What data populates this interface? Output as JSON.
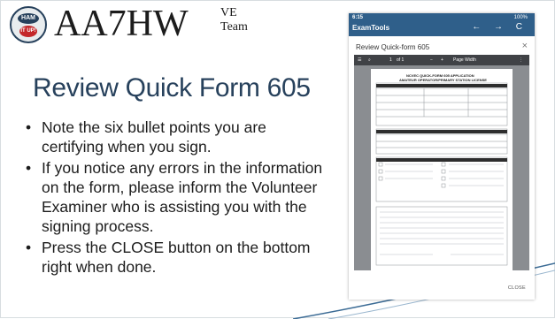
{
  "header": {
    "logo_top": "HAM",
    "logo_bottom": "IT UP!",
    "brand": "AA7HW",
    "brand_super": "VE",
    "brand_sub": "Team"
  },
  "slide": {
    "title": "Review Quick Form 605",
    "bullets": [
      "Note the six bullet points you are certifying when you sign.",
      "If you notice any errors in the information on the form, please inform the Volunteer Examiner who is assisting you with the signing process.",
      "Press the CLOSE button on the bottom right when done."
    ]
  },
  "app": {
    "status_time": "6:15",
    "battery": "100%",
    "app_name": "ExamTools",
    "nav_icons": "← → C",
    "dialog_title": "Review Quick-form 605",
    "close_x": "×",
    "pdf_toolbar": {
      "page": "1",
      "of": "of 1",
      "zoom": "Page Width"
    },
    "pdf_heading1": "NCVEC QUICK-FORM 605 APPLICATION",
    "pdf_heading2": "AMATEUR OPERATOR/PRIMARY STATION LICENSE",
    "close_button": "CLOSE"
  },
  "colors": {
    "title": "#27415c",
    "statusbar": "#2f5f8a",
    "pdf_toolbar": "#404246",
    "swoosh": "#3b6b95"
  }
}
